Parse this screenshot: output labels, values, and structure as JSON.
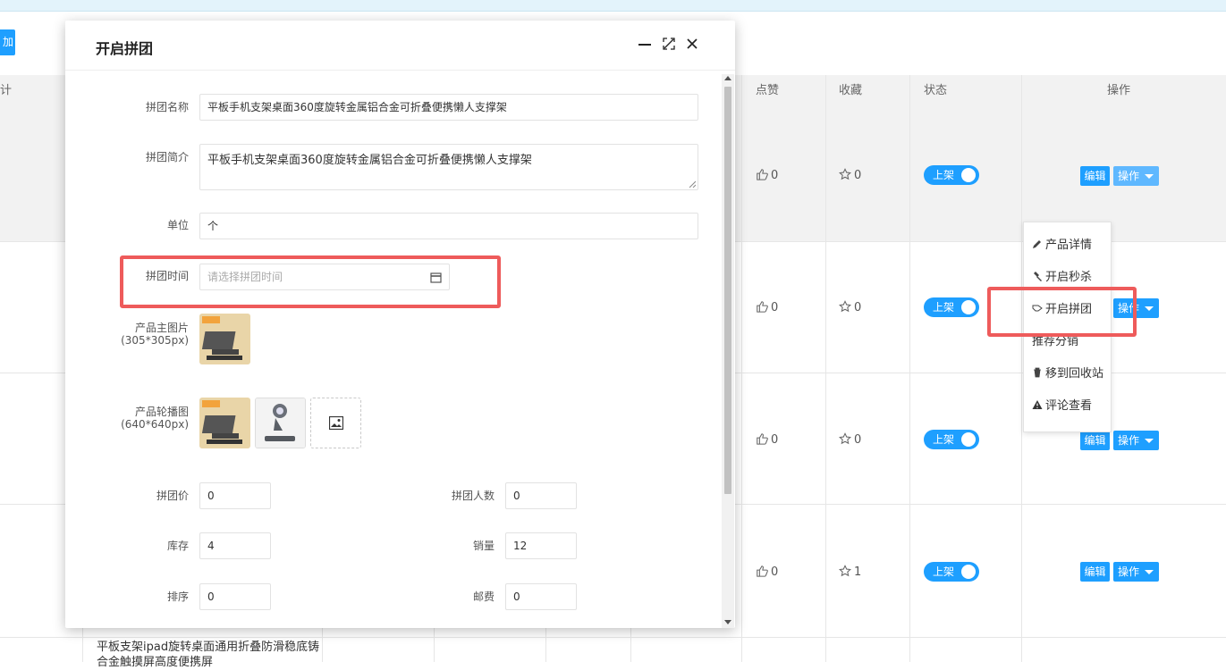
{
  "background": {
    "add_button_label": "加",
    "table_headers": {
      "likes": "点赞",
      "favorites": "收藏",
      "status": "状态",
      "actions": "操作"
    },
    "rows": [
      {
        "likes": "0",
        "favorites": "0",
        "status": "上架",
        "edit": "编辑",
        "op": "操作"
      },
      {
        "likes": "0",
        "favorites": "0",
        "status": "上架",
        "edit": "编辑",
        "op": "操作"
      },
      {
        "likes": "0",
        "favorites": "0",
        "status": "上架",
        "edit": "编辑",
        "op": "操作"
      },
      {
        "likes": "0",
        "favorites": "1",
        "status": "上架",
        "edit": "编辑",
        "op": "操作"
      }
    ],
    "bottom_product_name": "平板支架ipad旋转桌面通用折叠防滑稳底铸合金触摸屏高度便携屏"
  },
  "dropdown": {
    "items": [
      {
        "label": "产品详情",
        "icon": "pencil-icon"
      },
      {
        "label": "开启秒杀",
        "icon": "gavel-icon"
      },
      {
        "label": "开启拼团",
        "icon": "group-buy-icon"
      },
      {
        "label": "推荐分销",
        "icon": ""
      },
      {
        "label": "移到回收站",
        "icon": "trash-icon"
      },
      {
        "label": "评论查看",
        "icon": "warning-icon"
      }
    ]
  },
  "modal": {
    "title": "开启拼团",
    "form": {
      "name_label": "拼团名称",
      "name_value": "平板手机支架桌面360度旋转金属铝合金可折叠便携懒人支撑架",
      "intro_label": "拼团简介",
      "intro_value": "平板手机支架桌面360度旋转金属铝合金可折叠便携懒人支撑架",
      "unit_label": "单位",
      "unit_value": "个",
      "time_label": "拼团时间",
      "time_placeholder": "请选择拼团时间",
      "main_image_label": "产品主图片",
      "main_image_size": "(305*305px)",
      "carousel_label": "产品轮播图",
      "carousel_size": "(640*640px)",
      "price_label": "拼团价",
      "price_value": "0",
      "people_label": "拼团人数",
      "people_value": "0",
      "stock_label": "库存",
      "stock_value": "4",
      "sales_label": "销量",
      "sales_value": "12",
      "sort_label": "排序",
      "sort_value": "0",
      "postage_label": "邮费",
      "postage_value": "0"
    }
  },
  "colors": {
    "primary": "#1e9fff",
    "highlight": "#ee5b5b"
  }
}
